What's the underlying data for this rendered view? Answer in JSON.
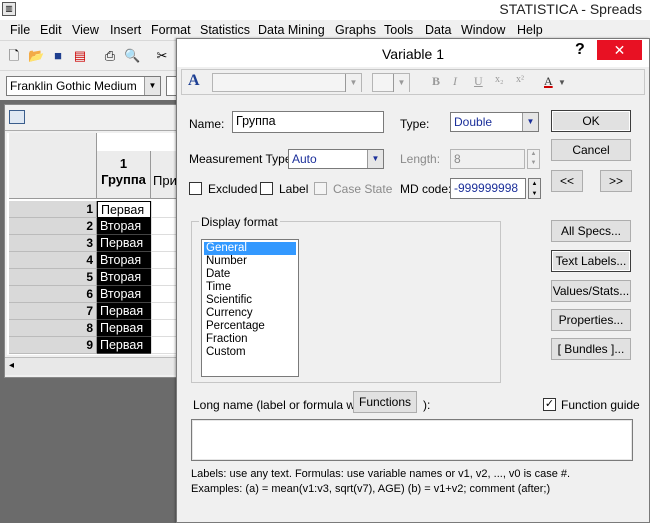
{
  "app": {
    "title": "STATISTICA - Spreads",
    "menu": [
      "File",
      "Edit",
      "View",
      "Insert",
      "Format",
      "Statistics",
      "Data Mining",
      "Graphs",
      "Tools",
      "Data",
      "Window",
      "Help"
    ],
    "font_name": "Franklin Gothic Medium"
  },
  "sheet": {
    "col1_number": "1",
    "col1_name": "Группа",
    "col2_partial": "При",
    "rows": [
      {
        "num": "1",
        "value": "Первая"
      },
      {
        "num": "2",
        "value": "Вторая"
      },
      {
        "num": "3",
        "value": "Первая"
      },
      {
        "num": "4",
        "value": "Вторая"
      },
      {
        "num": "5",
        "value": "Вторая"
      },
      {
        "num": "6",
        "value": "Вторая"
      },
      {
        "num": "7",
        "value": "Первая"
      },
      {
        "num": "8",
        "value": "Первая"
      },
      {
        "num": "9",
        "value": "Первая"
      }
    ]
  },
  "dialog": {
    "title": "Variable 1",
    "help": "?",
    "close": "✕",
    "name_label": "Name:",
    "name_value": "Группа",
    "type_label": "Type:",
    "type_value": "Double",
    "measurement_label": "Measurement Type:",
    "measurement_value": "Auto",
    "length_label": "Length:",
    "length_value": "8",
    "excluded_label": "Excluded",
    "label_label": "Label",
    "case_state_label": "Case State",
    "md_code_label": "MD code:",
    "md_code_value": "-999999998",
    "display_format_label": "Display format",
    "formats": [
      "General",
      "Number",
      "Date",
      "Time",
      "Scientific",
      "Currency",
      "Percentage",
      "Fraction",
      "Custom"
    ],
    "selected_format": "General",
    "long_name_label": "Long name (label or formula with",
    "functions_button": "Functions",
    "long_name_suffix": "):",
    "function_guide_label": "Function guide",
    "function_guide_checked": true,
    "help_line1": "Labels: use any text.  Formulas: use variable names or v1, v2, ..., v0 is case #.",
    "help_line2": "Examples:   (a) = mean(v1:v3, sqrt(v7), AGE)   (b) = v1+v2; comment (after;)",
    "buttons": {
      "ok": "OK",
      "cancel": "Cancel",
      "prev": "<<",
      "next": ">>",
      "all_specs": "All Specs...",
      "text_labels": "Text Labels...",
      "values_stats": "Values/Stats...",
      "properties": "Properties...",
      "bundles": "[ Bundles ]..."
    }
  }
}
